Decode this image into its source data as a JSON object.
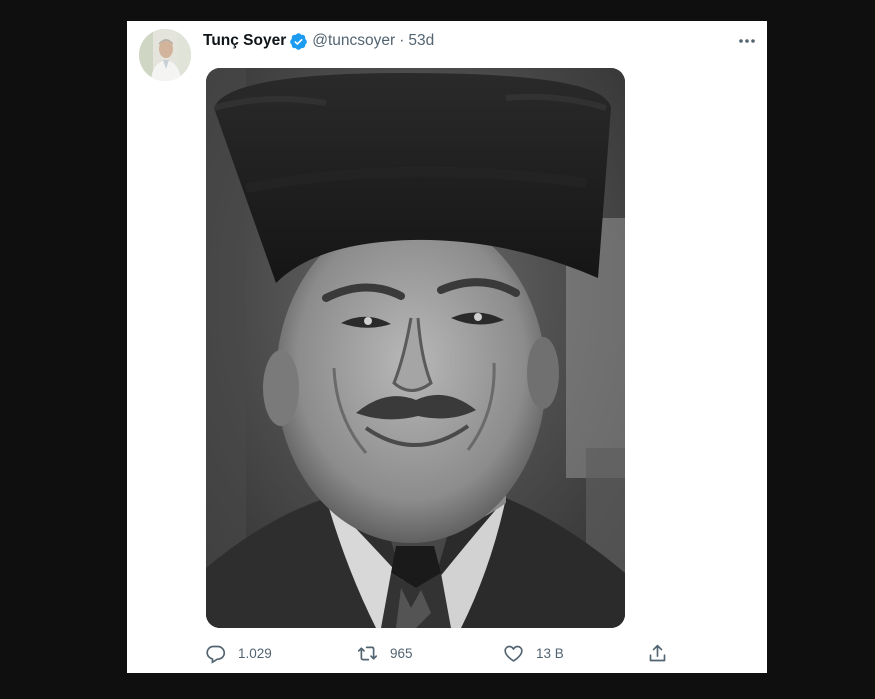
{
  "tweet": {
    "author_name": "Tunç Soyer",
    "author_handle": "@tuncsoyer",
    "separator": "·",
    "age": "53d",
    "verified": true,
    "more_icon": "more-horizontal-icon",
    "image_alt": "Black and white portrait photograph of a smiling man wearing a fur kalpak hat"
  },
  "actions": {
    "reply_count": "1.029",
    "retweet_count": "965",
    "like_count": "13 B",
    "reply_icon": "reply-icon",
    "retweet_icon": "retweet-icon",
    "like_icon": "heart-icon",
    "share_icon": "share-icon"
  },
  "colors": {
    "background": "#0f0f0f",
    "card": "#ffffff",
    "verified_blue": "#1d9bf0",
    "secondary_text": "#536471",
    "primary_text": "#0f1419"
  }
}
